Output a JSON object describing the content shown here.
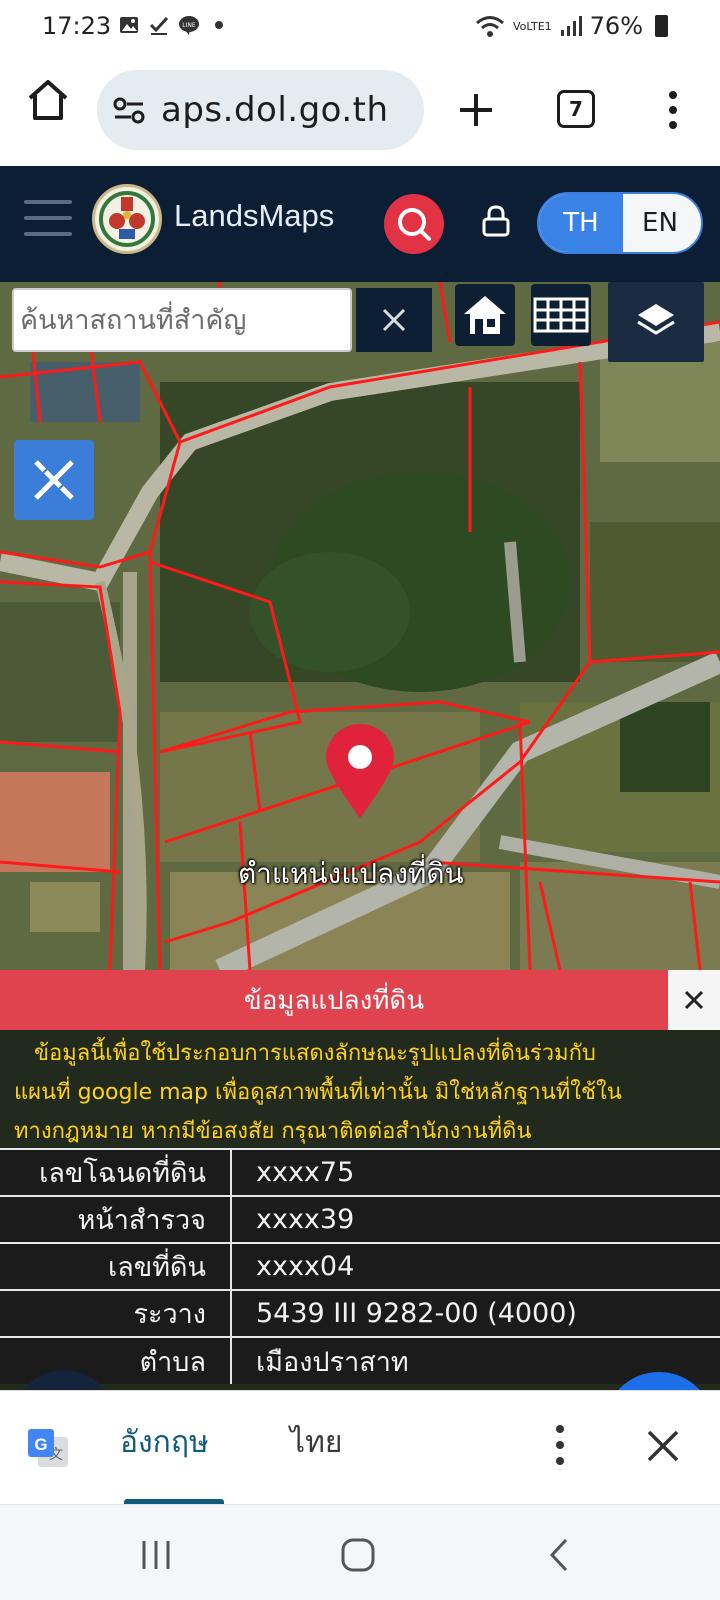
{
  "status_bar": {
    "time": "17:23",
    "battery": "76%",
    "network": "VoLTE1"
  },
  "browser": {
    "url": "aps.dol.go.th",
    "tab_count": "7"
  },
  "site": {
    "title": "LandsMaps",
    "lang_th": "TH",
    "lang_en": "EN",
    "active_lang": "TH"
  },
  "map": {
    "search_placeholder": "ค้นหาสถานที่สำคัญ",
    "marker_label": "ตำแหน่งแปลงที่ดิน"
  },
  "info_panel": {
    "title": "ข้อมูลแปลงที่ดิน",
    "disclaimer": [
      "ข้อมูลนี้เพื่อใช้ประกอบการแสดงลักษณะรูปแปลงที่ดินร่วมกับ",
      "แผนที่ google map เพื่อดูสภาพพื้นที่เท่านั้น มิใช่หลักฐานที่ใช้ใน",
      "ทางกฎหมาย หากมีข้อสงสัย กรุณาติดต่อสำนักงานที่ดิน"
    ],
    "rows": [
      {
        "label": "เลขโฉนดที่ดิน",
        "value": "xxxx75"
      },
      {
        "label": "หน้าสำรวจ",
        "value": "xxxx39"
      },
      {
        "label": "เลขที่ดิน",
        "value": "xxxx04"
      },
      {
        "label": "ระวาง",
        "value": "5439 III 9282-00 (4000)"
      },
      {
        "label": "ตำบล",
        "value": "เมืองปราสาท"
      }
    ]
  },
  "translate_bar": {
    "tab_english": "อังกฤษ",
    "tab_thai": "ไทย",
    "active": "อังกฤษ"
  },
  "colors": {
    "header_bg": "#0b1e33",
    "accent_red": "#e23344",
    "accent_blue": "#3b82e6",
    "parcel_line": "#ff1a1a",
    "disclaimer_text": "#ffd21a"
  }
}
